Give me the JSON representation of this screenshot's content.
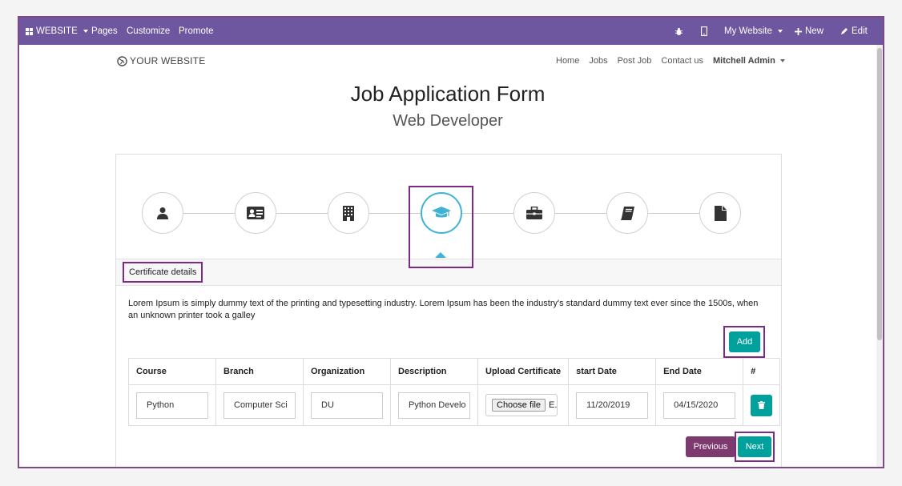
{
  "topbar": {
    "website_label": "WEBSITE",
    "pages_label": "Pages",
    "customize_label": "Customize",
    "promote_label": "Promote",
    "my_website_label": "My Website",
    "new_label": "New",
    "edit_label": "Edit",
    "bg_color": "#6f57a0"
  },
  "site": {
    "brand": "YOUR WEBSITE",
    "nav": [
      "Home",
      "Jobs",
      "Post Job",
      "Contact us"
    ],
    "user": "Mitchell Admin"
  },
  "page": {
    "title": "Job Application Form",
    "subtitle": "Web Developer"
  },
  "steps": {
    "icons": [
      "user-icon",
      "id-card-icon",
      "building-icon",
      "graduation-cap-icon",
      "briefcase-icon",
      "book-icon",
      "file-icon"
    ],
    "active_index": 3,
    "active_color": "#3fb2d6"
  },
  "section": {
    "title": "Certificate details",
    "description": "Lorem Ipsum is simply dummy text of the printing and typesetting industry. Lorem Ipsum has been the industry's standard dummy text ever since the 1500s, when an unknown printer took a galley"
  },
  "table": {
    "add_label": "Add",
    "headers": [
      "Course",
      "Branch",
      "Organization",
      "Description",
      "Upload Certificate",
      "start Date",
      "End Date",
      "#"
    ],
    "row": {
      "course": "Python",
      "branch": "Computer Sci",
      "organization": "DU",
      "description": "Python Develo",
      "choose_file_label": "Choose file",
      "file_status": "E...",
      "start_date": "11/20/2019",
      "end_date": "04/15/2020"
    }
  },
  "footer": {
    "previous_label": "Previous",
    "next_label": "Next",
    "teal_color": "#00a09d",
    "highlight_color": "#7c2a85"
  }
}
